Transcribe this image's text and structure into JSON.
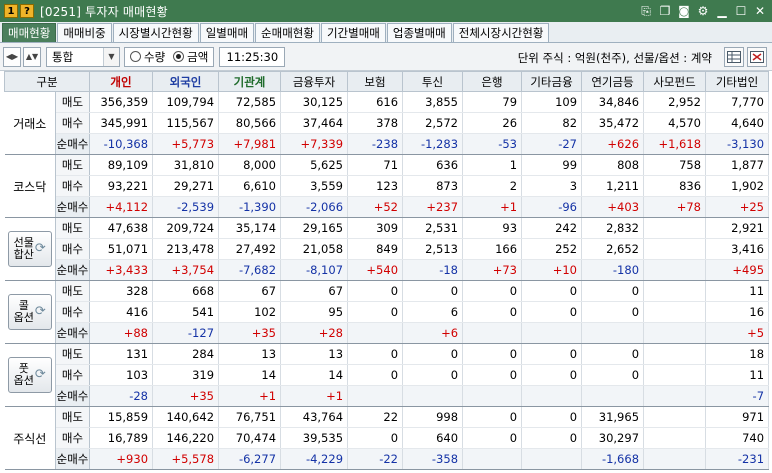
{
  "window": {
    "badge": "1",
    "badge2": "?",
    "title": "[0251] 투자자 매매현황",
    "icons": [
      "link-icon",
      "copy-icon",
      "camera-icon",
      "gear-icon",
      "minimize-icon",
      "maximize-icon",
      "close-icon"
    ]
  },
  "tabs": [
    {
      "label": "매매현황",
      "active": true
    },
    {
      "label": "매매비중",
      "active": false
    },
    {
      "label": "시장별시간현황",
      "active": false
    },
    {
      "label": "일별매매",
      "active": false
    },
    {
      "label": "순매매현황",
      "active": false
    },
    {
      "label": "기간별매매",
      "active": false
    },
    {
      "label": "업종별매매",
      "active": false
    },
    {
      "label": "전체시장시간현황",
      "active": false
    }
  ],
  "toolbar": {
    "market_select": "통합",
    "radio_qty": "수량",
    "radio_amount": "금액",
    "selected": "금액",
    "time": "11:25:30",
    "unit_text": "단위 주식 : 억원(천주), 선물/옵션 : 계약"
  },
  "columns": [
    "구분",
    "개인",
    "외국인",
    "기관계",
    "금융투자",
    "보험",
    "투신",
    "은행",
    "기타금융",
    "연기금등",
    "사모펀드",
    "기타법인"
  ],
  "row_labels": {
    "sell": "매도",
    "buy": "매수",
    "net": "순매수"
  },
  "markets": [
    {
      "name": "거래소",
      "button": false,
      "sell": [
        "356,359",
        "109,794",
        "72,585",
        "30,125",
        "616",
        "3,855",
        "79",
        "109",
        "34,846",
        "2,952",
        "7,770"
      ],
      "buy": [
        "345,991",
        "115,567",
        "80,566",
        "37,464",
        "378",
        "2,572",
        "26",
        "82",
        "35,472",
        "4,570",
        "4,640"
      ],
      "net": [
        "-10,368",
        "+5,773",
        "+7,981",
        "+7,339",
        "-238",
        "-1,283",
        "-53",
        "-27",
        "+626",
        "+1,618",
        "-3,130"
      ]
    },
    {
      "name": "코스닥",
      "button": false,
      "sell": [
        "89,109",
        "31,810",
        "8,000",
        "5,625",
        "71",
        "636",
        "1",
        "99",
        "808",
        "758",
        "1,877"
      ],
      "buy": [
        "93,221",
        "29,271",
        "6,610",
        "3,559",
        "123",
        "873",
        "2",
        "3",
        "1,211",
        "836",
        "1,902"
      ],
      "net": [
        "+4,112",
        "-2,539",
        "-1,390",
        "-2,066",
        "+52",
        "+237",
        "+1",
        "-96",
        "+403",
        "+78",
        "+25"
      ]
    },
    {
      "name": "선물합산",
      "name_lines": [
        "선물",
        "합산"
      ],
      "button": true,
      "sell": [
        "47,638",
        "209,724",
        "35,174",
        "29,165",
        "309",
        "2,531",
        "93",
        "242",
        "2,832",
        "",
        "2,921"
      ],
      "buy": [
        "51,071",
        "213,478",
        "27,492",
        "21,058",
        "849",
        "2,513",
        "166",
        "252",
        "2,652",
        "",
        "3,416"
      ],
      "net": [
        "+3,433",
        "+3,754",
        "-7,682",
        "-8,107",
        "+540",
        "-18",
        "+73",
        "+10",
        "-180",
        "",
        "+495"
      ]
    },
    {
      "name": "콜옵션",
      "name_lines": [
        "콜",
        "옵션"
      ],
      "button": true,
      "sell": [
        "328",
        "668",
        "67",
        "67",
        "0",
        "0",
        "0",
        "0",
        "0",
        "",
        "11"
      ],
      "buy": [
        "416",
        "541",
        "102",
        "95",
        "0",
        "6",
        "0",
        "0",
        "0",
        "",
        "16"
      ],
      "net": [
        "+88",
        "-127",
        "+35",
        "+28",
        "",
        "+6",
        "",
        "",
        "",
        "",
        "+5"
      ]
    },
    {
      "name": "풋옵션",
      "name_lines": [
        "풋",
        "옵션"
      ],
      "button": true,
      "sell": [
        "131",
        "284",
        "13",
        "13",
        "0",
        "0",
        "0",
        "0",
        "0",
        "",
        "18"
      ],
      "buy": [
        "103",
        "319",
        "14",
        "14",
        "0",
        "0",
        "0",
        "0",
        "0",
        "",
        "11"
      ],
      "net": [
        "-28",
        "+35",
        "+1",
        "+1",
        "",
        "",
        "",
        "",
        "",
        "",
        "-7"
      ]
    },
    {
      "name": "주식선",
      "button": false,
      "sell": [
        "15,859",
        "140,642",
        "76,751",
        "43,764",
        "22",
        "998",
        "0",
        "0",
        "31,965",
        "",
        "971"
      ],
      "buy": [
        "16,789",
        "146,220",
        "70,474",
        "39,535",
        "0",
        "640",
        "0",
        "0",
        "30,297",
        "",
        "740"
      ],
      "net": [
        "+930",
        "+5,578",
        "-6,277",
        "-4,229",
        "-22",
        "-358",
        "",
        "",
        "-1,668",
        "",
        "-231"
      ]
    }
  ],
  "colors": {
    "title_bg": "#3f7a4f",
    "active_tab_bg": "#4a7f5c",
    "positive": "#d10000",
    "negative": "#1432a6"
  }
}
